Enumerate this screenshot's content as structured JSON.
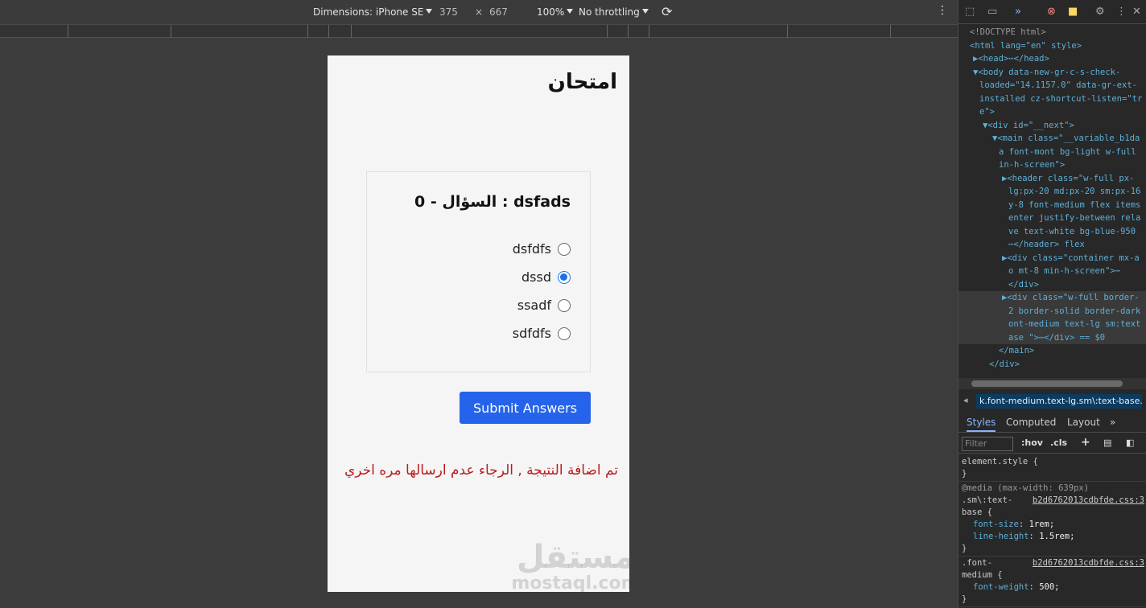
{
  "device_toolbar": {
    "dimensions_label": "Dimensions: iPhone SE",
    "width": "375",
    "times": "×",
    "height": "667",
    "zoom": "100%",
    "throttling": "No throttling"
  },
  "page": {
    "exam_title": "امتحان",
    "question_title": "dsfads : السؤال - 0",
    "options": [
      {
        "label": "dsfdfs",
        "checked": false
      },
      {
        "label": "dssd",
        "checked": true
      },
      {
        "label": "ssadf",
        "checked": false
      },
      {
        "label": "sdfdfs",
        "checked": false
      }
    ],
    "submit_label": "Submit Answers",
    "result_message": "تم اضافة النتيجة , الرجاء عدم ارسالها مره اخري",
    "watermark_logo": "مستقل",
    "watermark_url": "mostaql.com"
  },
  "devtools": {
    "dom_lines": [
      {
        "t": "<!DOCTYPE html>"
      },
      {
        "t": "<html lang=\"en\" style>"
      },
      {
        "t": "▶<head>⋯</head>"
      },
      {
        "t": "▼<body data-new-gr-c-s-check-"
      },
      {
        "t": "loaded=\"14.1157.0\" data-gr-ext-"
      },
      {
        "t": "installed cz-shortcut-listen=\"tr"
      },
      {
        "t": "e\">"
      },
      {
        "t": "▼<div id=\"__next\">"
      },
      {
        "t": "▼<main class=\"__variable_b1da"
      },
      {
        "t": "a font-mont bg-light w-full"
      },
      {
        "t": "in-h-screen\">"
      },
      {
        "t": "▶<header class=\"w-full  px-"
      },
      {
        "t": "lg:px-20 md:px-20 sm:px-16"
      },
      {
        "t": "y-8 font-medium flex items"
      },
      {
        "t": "enter justify-between rela"
      },
      {
        "t": "ve text-white bg-blue-950"
      },
      {
        "t": "⋯</header> flex"
      },
      {
        "t": "▶<div class=\"container mx-a"
      },
      {
        "t": "o mt-8 min-h-screen\">⋯"
      },
      {
        "t": "</div>"
      },
      {
        "t": "▶<div class=\"w-full border-"
      },
      {
        "t": "2 border-solid border-dark"
      },
      {
        "t": "ont-medium text-lg sm:text"
      },
      {
        "t": "ase  \">⋯</div> == $0"
      },
      {
        "t": "</main>"
      },
      {
        "t": "</div>"
      }
    ],
    "breadcrumb": "k.font-medium.text-lg.sm\\:text-base.",
    "tabs": [
      "Styles",
      "Computed",
      "Layout",
      "»"
    ],
    "filter_placeholder": "Filter",
    "hov": ":hov",
    "cls": ".cls",
    "styles": {
      "element_style": "element.style {",
      "close1": "}",
      "media": "@media (max-width: 639px)",
      "selector2": ".sm\\:text-",
      "selector2b": "base {",
      "source2": "b2d6762013cdbfde.css:3",
      "prop_fs": "font-size",
      "val_fs": "1rem;",
      "prop_lh": "line-height",
      "val_lh": "1.5rem;",
      "close2": "}",
      "selector3": ".font-",
      "selector3b": "medium {",
      "source3": "b2d6762013cdbfde.css:3",
      "prop_fw": "font-weight",
      "val_fw": "500;",
      "close3": "}"
    }
  },
  "colors": {
    "accent": "#2563eb",
    "error_text": "#b91c1c",
    "page_bg": "#f5f5f5"
  }
}
